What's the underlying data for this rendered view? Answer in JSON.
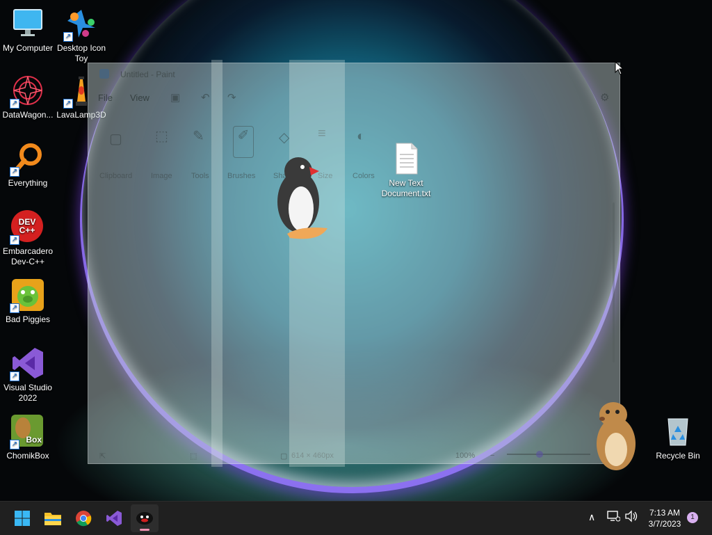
{
  "desktop": {
    "icons": [
      {
        "label": "My Computer"
      },
      {
        "label": "Desktop Icon Toy"
      },
      {
        "label": "DataWagon..."
      },
      {
        "label": "LavaLamp3D"
      },
      {
        "label": "Everything"
      },
      {
        "label": "Embarcadero Dev-C++"
      },
      {
        "label": "Bad Piggies"
      },
      {
        "label": "Visual Studio 2022"
      },
      {
        "label": "ChomikBox"
      },
      {
        "label": "New Text Document.txt"
      },
      {
        "label": "Recycle Bin"
      }
    ],
    "devcpp_logo_text": "DEV C++",
    "chomik_logo_text": "Box"
  },
  "paint": {
    "title": "Untitled - Paint",
    "menu": {
      "file": "File",
      "view": "View"
    },
    "groups": {
      "clipboard": "Clipboard",
      "image": "Image",
      "tools": "Tools",
      "brushes": "Brushes",
      "shapes": "Shapes",
      "size": "Size",
      "colors": "Colors"
    },
    "status": {
      "canvas_size": "614 × 460px",
      "zoom": "100%"
    }
  },
  "taskbar": {
    "apps": [
      "start",
      "file-explorer",
      "chrome",
      "visual-studio",
      "pingu"
    ],
    "clock_time": "7:13 AM",
    "clock_date": "3/7/2023",
    "notification_count": "1"
  }
}
